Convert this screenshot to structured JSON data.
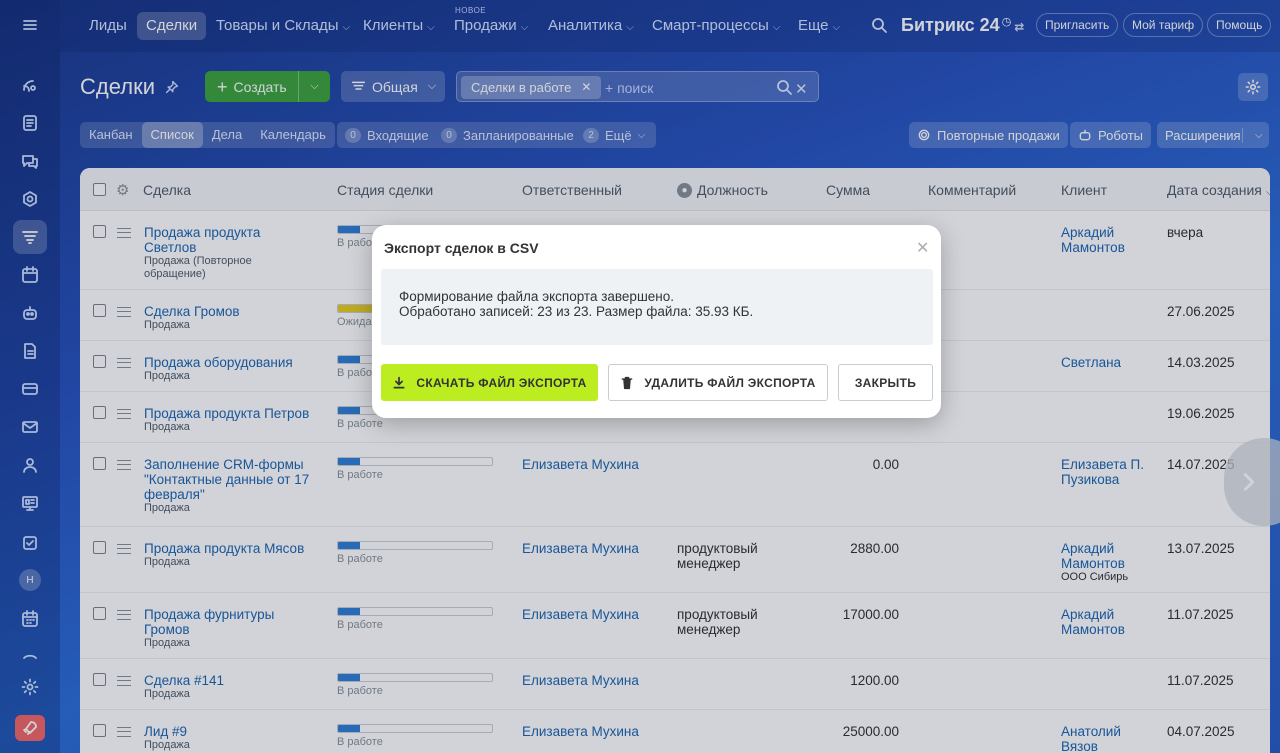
{
  "topnav": {
    "items": [
      {
        "label": "Лиды"
      },
      {
        "label": "Сделки"
      },
      {
        "label": "Товары и Склады"
      },
      {
        "label": "Клиенты"
      },
      {
        "label": "Продажи"
      },
      {
        "label": "Аналитика"
      },
      {
        "label": "Смарт-процессы"
      },
      {
        "label": "Еще"
      }
    ],
    "new_tag": "НОВОЕ",
    "logo": "Битрикс 24",
    "invite": "Пригласить",
    "tariff": "Мой тариф",
    "help": "Помощь"
  },
  "toolbar": {
    "title": "Сделки",
    "create": "Создать",
    "filter": "Общая",
    "search_chip": "Сделки в работе",
    "search_placeholder": "+ поиск"
  },
  "views": [
    "Канбан",
    "Список",
    "Дела",
    "Календарь"
  ],
  "counters": [
    {
      "count": "0",
      "label": "Входящие"
    },
    {
      "count": "0",
      "label": "Запланированные"
    },
    {
      "count": "2",
      "label": "Ещё"
    }
  ],
  "toolbar_buttons": {
    "repeat": "Повторные продажи",
    "robots": "Роботы",
    "extensions": "Расширения"
  },
  "columns": {
    "deal": "Сделка",
    "stage": "Стадия сделки",
    "responsible": "Ответственный",
    "position": "Должность",
    "sum": "Сумма",
    "comment": "Комментарий",
    "client": "Клиент",
    "created": "Дата создания"
  },
  "rows": [
    {
      "title": "Продажа продукта Светлов",
      "type": "Продажа (Повторное обращение)",
      "stage": "В работе",
      "stage_color": "#2f7fd8",
      "stage_progress": 0.14,
      "responsible": "",
      "position": "",
      "sum": "",
      "client": "Аркадий Мамонтов",
      "client_sub": "",
      "date": "вчера"
    },
    {
      "title": "Сделка Громов",
      "type": "Продажа",
      "stage": "Ожидание",
      "stage_color": "#e8cf21",
      "stage_progress": 0.28,
      "responsible": "",
      "position": "",
      "sum": "",
      "client": "",
      "client_sub": "",
      "date": "27.06.2025"
    },
    {
      "title": "Продажа оборудования",
      "type": "Продажа",
      "stage": "В работе",
      "stage_color": "#2f7fd8",
      "stage_progress": 0.14,
      "responsible": "",
      "position": "",
      "sum": "",
      "client": "Светлана",
      "client_sub": "",
      "date": "14.03.2025"
    },
    {
      "title": "Продажа продукта Петров",
      "type": "Продажа",
      "stage": "В работе",
      "stage_color": "#2f7fd8",
      "stage_progress": 0.14,
      "responsible": "",
      "position": "",
      "sum": "",
      "client": "",
      "client_sub": "",
      "date": "19.06.2025"
    },
    {
      "title": "Заполнение CRM-формы \"Контактные данные от 17 февраля\"",
      "type": "Продажа",
      "stage": "В работе",
      "stage_color": "#2f7fd8",
      "stage_progress": 0.14,
      "responsible": "Елизавета Мухина",
      "position": "",
      "sum": "0.00",
      "client": "Елизавета П. Пузикова",
      "client_sub": "",
      "date": "14.07.2025"
    },
    {
      "title": "Продажа продукта Мясов",
      "type": "Продажа",
      "stage": "В работе",
      "stage_color": "#2f7fd8",
      "stage_progress": 0.14,
      "responsible": "Елизавета Мухина",
      "position": "продуктовый менеджер",
      "sum": "2880.00",
      "client": "Аркадий Мамонтов",
      "client_sub": "ООО Сибирь",
      "date": "13.07.2025"
    },
    {
      "title": "Продажа фурнитуры Громов",
      "type": "Продажа",
      "stage": "В работе",
      "stage_color": "#2f7fd8",
      "stage_progress": 0.14,
      "responsible": "Елизавета Мухина",
      "position": "продуктовый менеджер",
      "sum": "17000.00",
      "client": "Аркадий Мамонтов",
      "client_sub": "",
      "date": "11.07.2025"
    },
    {
      "title": "Сделка #141",
      "type": "Продажа",
      "stage": "В работе",
      "stage_color": "#2f7fd8",
      "stage_progress": 0.14,
      "responsible": "Елизавета Мухина",
      "position": "",
      "sum": "1200.00",
      "client": "",
      "client_sub": "",
      "date": "11.07.2025"
    },
    {
      "title": "Лид #9",
      "type": "Продажа",
      "stage": "В работе",
      "stage_color": "#2f7fd8",
      "stage_progress": 0.14,
      "responsible": "Елизавета Мухина",
      "position": "",
      "sum": "25000.00",
      "client": "Анатолий Вязов",
      "client_sub": "",
      "date": "04.07.2025"
    }
  ],
  "dialog": {
    "title": "Экспорт сделок в CSV",
    "line1": "Формирование файла экспорта завершено.",
    "line2": "Обработано записей: 23 из 23. Размер файла: 35.93 КБ.",
    "download": "СКАЧАТЬ ФАЙЛ ЭКСПОРТА",
    "delete": "УДАЛИТЬ ФАЙЛ ЭКСПОРТА",
    "close": "ЗАКРЫТЬ",
    "download_color": "#bbed21"
  },
  "icons": {
    "rail": [
      "feed-icon",
      "tasks-icon",
      "chat-icon",
      "collab-icon",
      "crm-icon",
      "calendar-icon",
      "robot-icon",
      "docs-icon",
      "payment-icon",
      "mail-icon",
      "contacts-icon",
      "sites-icon",
      "checklist-icon",
      "calendar-grid-icon",
      "collapse-icon",
      "settings-icon",
      "rocket-icon"
    ]
  }
}
